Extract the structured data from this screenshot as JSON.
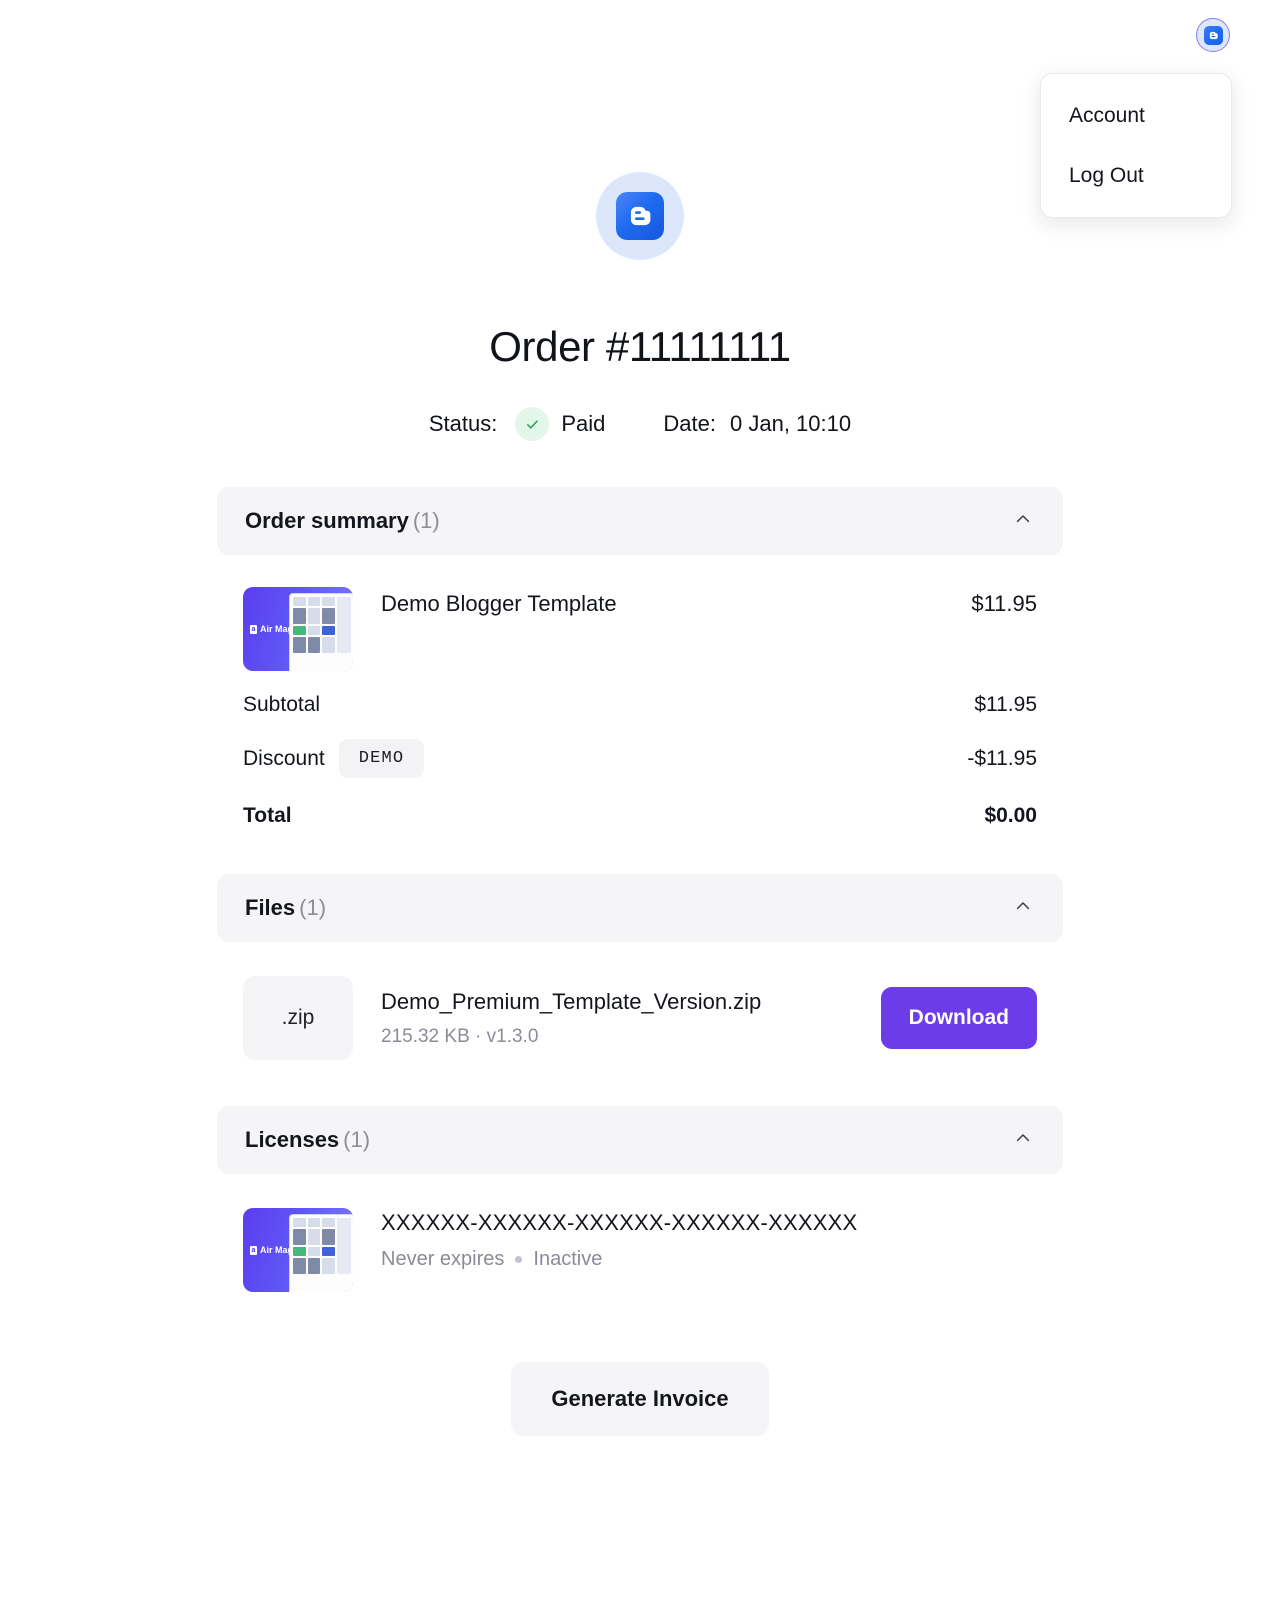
{
  "account_menu": {
    "avatar_icon": "blogger-avatar-icon",
    "items": [
      {
        "label": "Account"
      },
      {
        "label": "Log Out"
      }
    ]
  },
  "header": {
    "logo_icon": "blogger-logo-icon",
    "title": "Order #11111111",
    "status_label": "Status:",
    "status_value": "Paid",
    "status_icon": "check-icon",
    "date_label": "Date:",
    "date_value": "0 Jan, 10:10"
  },
  "order_summary": {
    "title": "Order summary",
    "count": "(1)",
    "toggle_icon": "chevron-up-icon",
    "items": [
      {
        "thumb_label": "Air Mag",
        "thumb_badge": "a",
        "name": "Demo Blogger Template",
        "price": "$11.95"
      }
    ],
    "subtotal_label": "Subtotal",
    "subtotal_value": "$11.95",
    "discount_label": "Discount",
    "discount_code": "DEMO",
    "discount_value": "-$11.95",
    "total_label": "Total",
    "total_value": "$0.00"
  },
  "files": {
    "title": "Files",
    "count": "(1)",
    "toggle_icon": "chevron-up-icon",
    "items": [
      {
        "ext": ".zip",
        "name": "Demo_Premium_Template_Version.zip",
        "meta": "215.32 KB · v1.3.0",
        "download_label": "Download"
      }
    ]
  },
  "licenses": {
    "title": "Licenses",
    "count": "(1)",
    "toggle_icon": "chevron-up-icon",
    "items": [
      {
        "thumb_label": "Air Mag",
        "thumb_badge": "a",
        "key": "XXXXXX-XXXXXX-XXXXXX-XXXXXX-XXXXXX",
        "expiry": "Never expires",
        "state": "Inactive"
      }
    ]
  },
  "footer": {
    "invoice_label": "Generate Invoice"
  },
  "colors": {
    "accent_purple": "#6c3ce9",
    "brand_blue": "#1f6bf0",
    "status_green": "#34a262",
    "surface_gray": "#f5f5f7",
    "muted_text": "#8b8b97"
  }
}
